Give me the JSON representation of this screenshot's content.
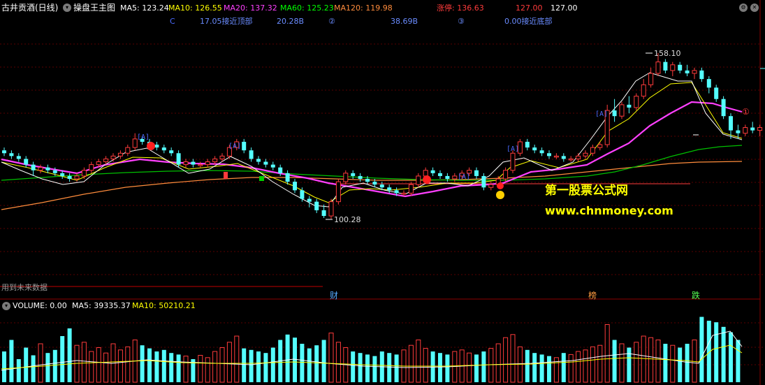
{
  "header": {
    "title": "古井贡酒(日线)",
    "indicator_name": "操盘王主图",
    "ma5": "MA5: 123.24",
    "ma10": "MA10: 126.55",
    "ma20": "MA20: 137.32",
    "ma60": "MA60: 125.23",
    "ma120": "MA120: 119.98",
    "limit_up": "涨停: 136.63",
    "limit_down": "127.00",
    "close": "127.00"
  },
  "info_row": {
    "c": "C",
    "near_top": "17.05接近顶部",
    "b1": "20.28B",
    "circle2": "②",
    "b2": "38.69B",
    "circle3": "③",
    "near_bottom": "0.00接近底部"
  },
  "annotations": {
    "high": "158.10",
    "low": "100.28",
    "circle1": "①",
    "future_data": "用到未来数据",
    "cai": "财",
    "bang": "榜",
    "die": "跌"
  },
  "watermark": {
    "line1": "第一股票公式网",
    "line2": "www.chnmoney.com"
  },
  "volume": {
    "label": "VOLUME: 0.00",
    "ma5": "MA5: 39335.37",
    "ma10": "MA10: 50210.21"
  },
  "colors": {
    "up": "#ff3b3b",
    "down": "#54ffff",
    "ma5": "#ffffff",
    "ma10": "#ffff00",
    "ma20": "#ff40ff",
    "ma60": "#00c000",
    "ma120": "#ff8c3c"
  },
  "chart_data": {
    "type": "candlestick",
    "y_axis_range": [
      95,
      165
    ],
    "extremes": {
      "high": 158.1,
      "low": 100.28
    },
    "ohlc": [
      [
        124,
        125,
        122,
        123
      ],
      [
        123,
        124,
        121,
        122
      ],
      [
        122,
        123,
        120,
        121
      ],
      [
        121,
        122,
        118,
        119
      ],
      [
        119,
        120,
        115,
        117
      ],
      [
        117,
        119,
        116,
        118
      ],
      [
        118,
        119,
        116,
        117
      ],
      [
        117,
        118,
        115,
        116
      ],
      [
        116,
        117,
        114,
        115
      ],
      [
        115,
        116,
        113,
        114
      ],
      [
        114,
        116,
        113,
        115
      ],
      [
        115,
        118,
        114,
        117
      ],
      [
        117,
        120,
        116,
        119
      ],
      [
        119,
        121,
        118,
        120
      ],
      [
        120,
        122,
        119,
        121
      ],
      [
        121,
        123,
        120,
        122
      ],
      [
        122,
        124,
        121,
        123
      ],
      [
        123,
        126,
        122,
        125
      ],
      [
        125,
        130,
        124,
        128
      ],
      [
        128,
        129,
        126,
        127
      ],
      [
        127,
        128,
        125,
        126
      ],
      [
        126,
        127,
        124,
        125
      ],
      [
        125,
        126,
        123,
        124
      ],
      [
        124,
        125,
        122,
        123
      ],
      [
        123,
        124,
        118,
        119
      ],
      [
        119,
        121,
        118,
        120
      ],
      [
        120,
        121,
        118,
        119
      ],
      [
        119,
        120,
        118,
        119
      ],
      [
        119,
        121,
        118,
        120
      ],
      [
        120,
        122,
        119,
        121
      ],
      [
        121,
        123,
        120,
        122
      ],
      [
        122,
        126,
        121,
        125
      ],
      [
        125,
        128,
        124,
        127
      ],
      [
        127,
        128,
        123,
        124
      ],
      [
        124,
        125,
        120,
        121
      ],
      [
        121,
        122,
        119,
        120
      ],
      [
        120,
        121,
        118,
        119
      ],
      [
        119,
        120,
        117,
        118
      ],
      [
        118,
        119,
        115,
        116
      ],
      [
        116,
        117,
        112,
        113
      ],
      [
        113,
        114,
        109,
        110
      ],
      [
        110,
        111,
        106,
        107
      ],
      [
        107,
        108,
        104,
        106
      ],
      [
        106,
        107,
        102,
        103
      ],
      [
        103,
        105,
        100.28,
        101
      ],
      [
        101,
        107,
        100,
        106
      ],
      [
        106,
        114,
        105,
        113
      ],
      [
        113,
        117,
        112,
        116
      ],
      [
        116,
        117,
        114,
        115
      ],
      [
        115,
        116,
        113,
        114
      ],
      [
        114,
        115,
        112,
        113
      ],
      [
        113,
        114,
        111,
        112
      ],
      [
        112,
        113,
        110,
        111
      ],
      [
        111,
        112,
        109,
        110
      ],
      [
        110,
        111,
        108,
        109
      ],
      [
        109,
        110,
        108,
        109
      ],
      [
        109,
        113,
        108,
        112
      ],
      [
        112,
        116,
        111,
        115
      ],
      [
        115,
        118,
        114,
        117
      ],
      [
        117,
        118,
        115,
        116
      ],
      [
        116,
        117,
        114,
        115
      ],
      [
        115,
        116,
        113,
        114
      ],
      [
        114,
        116,
        113,
        115
      ],
      [
        115,
        117,
        114,
        116
      ],
      [
        116,
        118,
        115,
        117
      ],
      [
        117,
        118,
        114,
        115
      ],
      [
        115,
        116,
        110,
        111
      ],
      [
        111,
        113,
        110,
        112
      ],
      [
        112,
        115,
        111,
        114
      ],
      [
        114,
        118,
        113,
        117
      ],
      [
        117,
        124,
        116,
        123
      ],
      [
        123,
        128,
        122,
        127
      ],
      [
        127,
        128,
        124,
        125
      ],
      [
        125,
        126,
        123,
        124
      ],
      [
        124,
        125,
        122,
        123
      ],
      [
        123,
        124,
        121,
        122
      ],
      [
        122,
        123,
        121,
        122
      ],
      [
        122,
        123,
        120,
        121
      ],
      [
        121,
        122,
        120,
        121
      ],
      [
        121,
        123,
        120,
        122
      ],
      [
        122,
        124,
        121,
        123
      ],
      [
        123,
        126,
        122,
        125
      ],
      [
        125,
        127,
        124,
        126
      ],
      [
        126,
        140,
        125,
        138
      ],
      [
        138,
        142,
        134,
        136
      ],
      [
        136,
        141,
        135,
        140
      ],
      [
        140,
        143,
        137,
        139
      ],
      [
        139,
        144,
        138,
        143
      ],
      [
        143,
        149,
        142,
        147
      ],
      [
        147,
        153,
        146,
        151
      ],
      [
        151,
        158.1,
        150,
        155
      ],
      [
        155,
        156,
        151,
        152
      ],
      [
        152,
        155,
        150,
        154
      ],
      [
        154,
        155,
        151,
        152
      ],
      [
        152,
        154,
        150,
        151
      ],
      [
        151,
        153,
        149,
        152
      ],
      [
        152,
        153,
        148,
        149
      ],
      [
        149,
        150,
        144,
        146
      ],
      [
        146,
        147,
        141,
        142
      ],
      [
        142,
        143,
        135,
        136
      ],
      [
        136,
        137,
        128,
        131
      ],
      [
        131,
        133,
        128,
        130
      ],
      [
        130,
        133,
        129,
        132
      ],
      [
        132,
        134,
        130,
        131
      ],
      [
        131,
        133,
        129,
        132
      ],
      [
        132,
        133,
        130,
        131
      ]
    ],
    "volume": [
      40,
      55,
      30,
      45,
      35,
      50,
      38,
      42,
      60,
      70,
      48,
      52,
      40,
      45,
      38,
      50,
      42,
      46,
      55,
      48,
      44,
      40,
      42,
      38,
      36,
      34,
      30,
      35,
      32,
      40,
      45,
      52,
      60,
      44,
      42,
      40,
      38,
      45,
      55,
      62,
      58,
      50,
      44,
      48,
      55,
      64,
      52,
      45,
      40,
      38,
      36,
      34,
      40,
      38,
      36,
      42,
      48,
      55,
      44,
      40,
      38,
      36,
      40,
      42,
      38,
      36,
      40,
      44,
      50,
      58,
      62,
      46,
      42,
      38,
      36,
      34,
      32,
      38,
      36,
      40,
      42,
      46,
      48,
      75,
      55,
      50,
      45,
      52,
      60,
      58,
      55,
      50,
      48,
      45,
      50,
      55,
      85,
      80,
      78,
      72,
      65,
      55
    ]
  }
}
